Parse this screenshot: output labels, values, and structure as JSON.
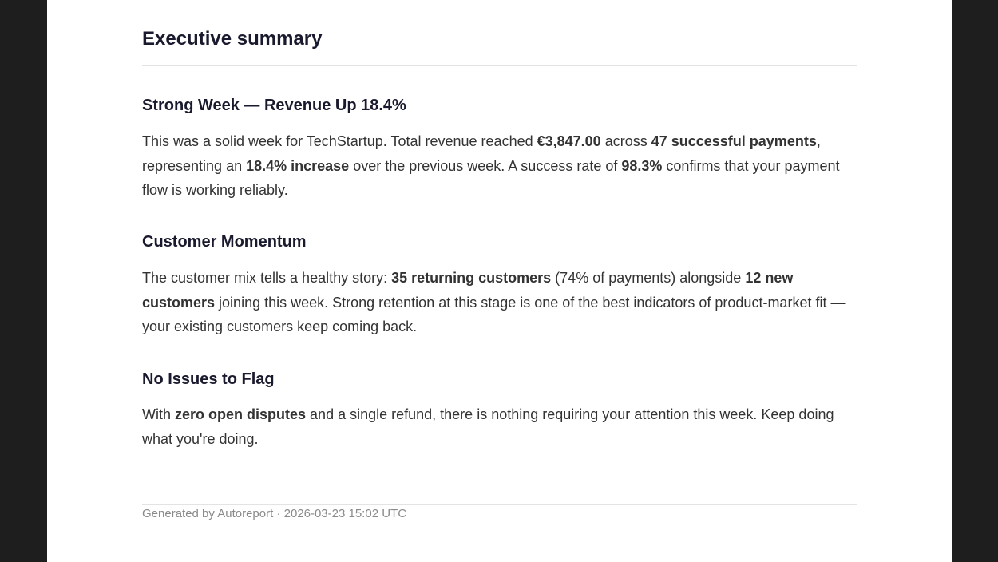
{
  "document": {
    "title": "Executive summary"
  },
  "sections": [
    {
      "heading": "Strong Week — Revenue Up 18.4%",
      "body": [
        {
          "t": "This was a solid week for TechStartup. Total revenue reached "
        },
        {
          "t": "€3,847.00",
          "b": true
        },
        {
          "t": " across "
        },
        {
          "t": "47 successful payments",
          "b": true
        },
        {
          "t": ", representing an "
        },
        {
          "t": "18.4% increase",
          "b": true
        },
        {
          "t": " over the previous week. A success rate of "
        },
        {
          "t": "98.3%",
          "b": true
        },
        {
          "t": " confirms that your payment flow is working reliably."
        }
      ]
    },
    {
      "heading": "Customer Momentum",
      "body": [
        {
          "t": "The customer mix tells a healthy story: "
        },
        {
          "t": "35 returning customers",
          "b": true
        },
        {
          "t": " (74% of payments) alongside "
        },
        {
          "t": "12 new customers",
          "b": true
        },
        {
          "t": " joining this week. Strong retention at this stage is one of the best indicators of product-market fit — your existing customers keep coming back."
        }
      ]
    },
    {
      "heading": "No Issues to Flag",
      "body": [
        {
          "t": "With "
        },
        {
          "t": "zero open disputes",
          "b": true
        },
        {
          "t": " and a single refund, there is nothing requiring your attention this week. Keep doing what you're doing."
        }
      ]
    }
  ],
  "footer": {
    "text": "Generated by Autoreport · 2026-03-23 15:02 UTC"
  }
}
